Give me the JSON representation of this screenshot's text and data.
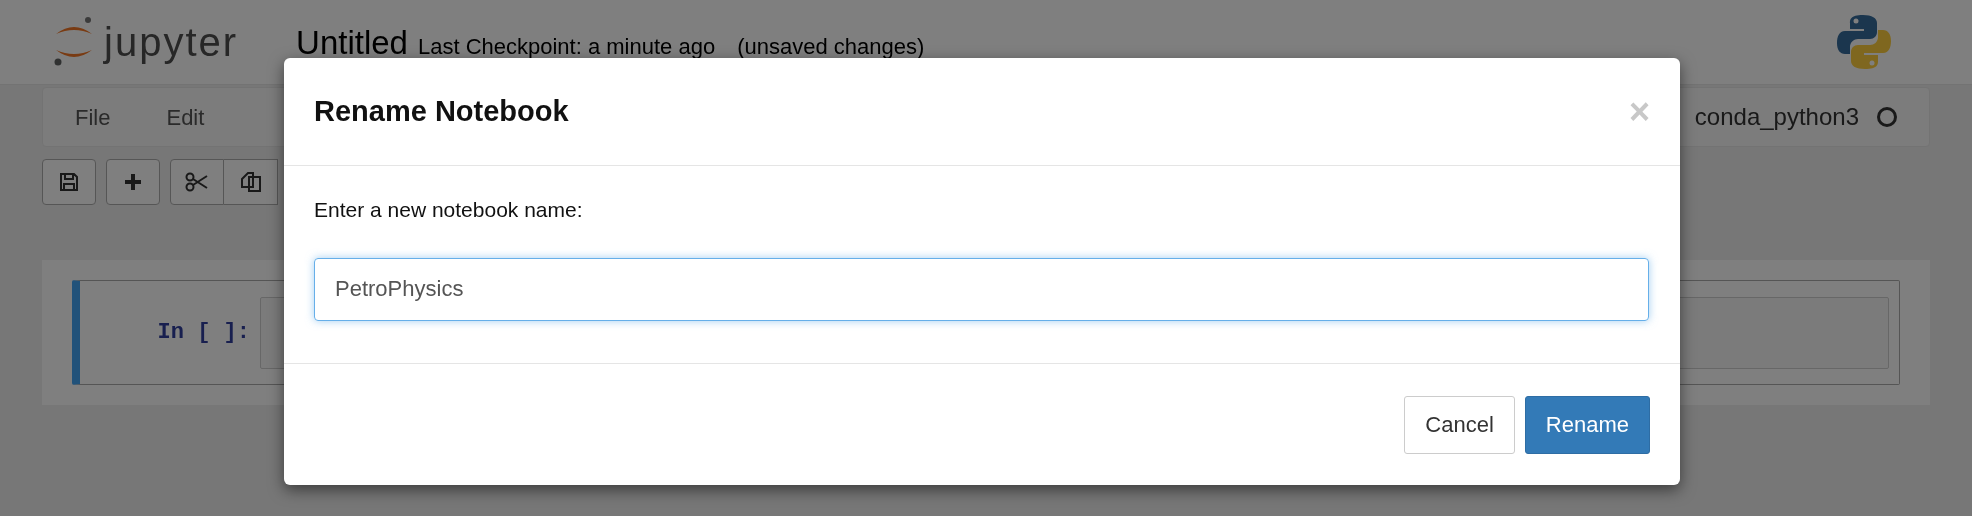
{
  "header": {
    "logo_text": "jupyter",
    "notebook_name": "Untitled",
    "checkpoint": "Last Checkpoint: a minute ago",
    "autosave_status": "(unsaved changes)"
  },
  "menubar": {
    "items": [
      "File",
      "Edit"
    ],
    "kernel_name": "conda_python3",
    "kernel_busy": false
  },
  "cell": {
    "prompt": "In [ ]:",
    "selected": true
  },
  "dialog": {
    "title": "Rename Notebook",
    "close": "×",
    "label": "Enter a new notebook name:",
    "value": "PetroPhysics",
    "buttons": [
      {
        "label": "Cancel",
        "kind": "default"
      },
      {
        "label": "Rename",
        "kind": "primary"
      }
    ]
  }
}
